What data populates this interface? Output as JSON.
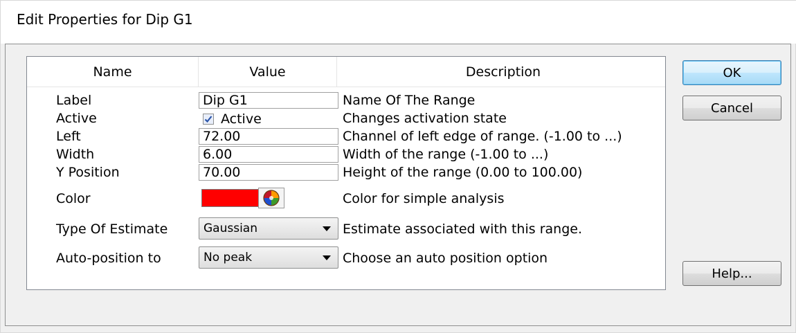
{
  "window": {
    "title": "Edit Properties for Dip G1"
  },
  "grid": {
    "columns": [
      "Name",
      "Value",
      "Description"
    ],
    "rows": [
      {
        "name": "Label",
        "value": "Dip G1",
        "description": "Name Of The Range",
        "kind": "text"
      },
      {
        "name": "Active",
        "value": "Active",
        "checked": true,
        "description": "Changes activation state",
        "kind": "checkbox"
      },
      {
        "name": "Left",
        "value": "72.00",
        "description": "Channel of left edge of range. (-1.00 to ...)",
        "kind": "text"
      },
      {
        "name": "Width",
        "value": "6.00",
        "description": "Width of the range (-1.00 to ...)",
        "kind": "text"
      },
      {
        "name": "Y Position",
        "value": "70.00",
        "description": "Height of the range (0.00 to 100.00)",
        "kind": "text"
      },
      {
        "name": "Color",
        "value": "#ff0000",
        "description": "Color for simple analysis",
        "kind": "color"
      },
      {
        "name": "Type Of Estimate",
        "value": "Gaussian",
        "description": "Estimate associated with this range.",
        "kind": "select"
      },
      {
        "name": "Auto-position to",
        "value": "No peak",
        "description": "Choose an auto position option",
        "kind": "select"
      }
    ]
  },
  "buttons": {
    "ok": "OK",
    "cancel": "Cancel",
    "help": "Help..."
  },
  "icons": {
    "color_picker": "color-wheel-icon",
    "dropdown": "chevron-down-icon",
    "check": "checkmark-icon"
  },
  "colors": {
    "swatch": "#ff0000",
    "default_button_border": "#3c7fb1"
  }
}
